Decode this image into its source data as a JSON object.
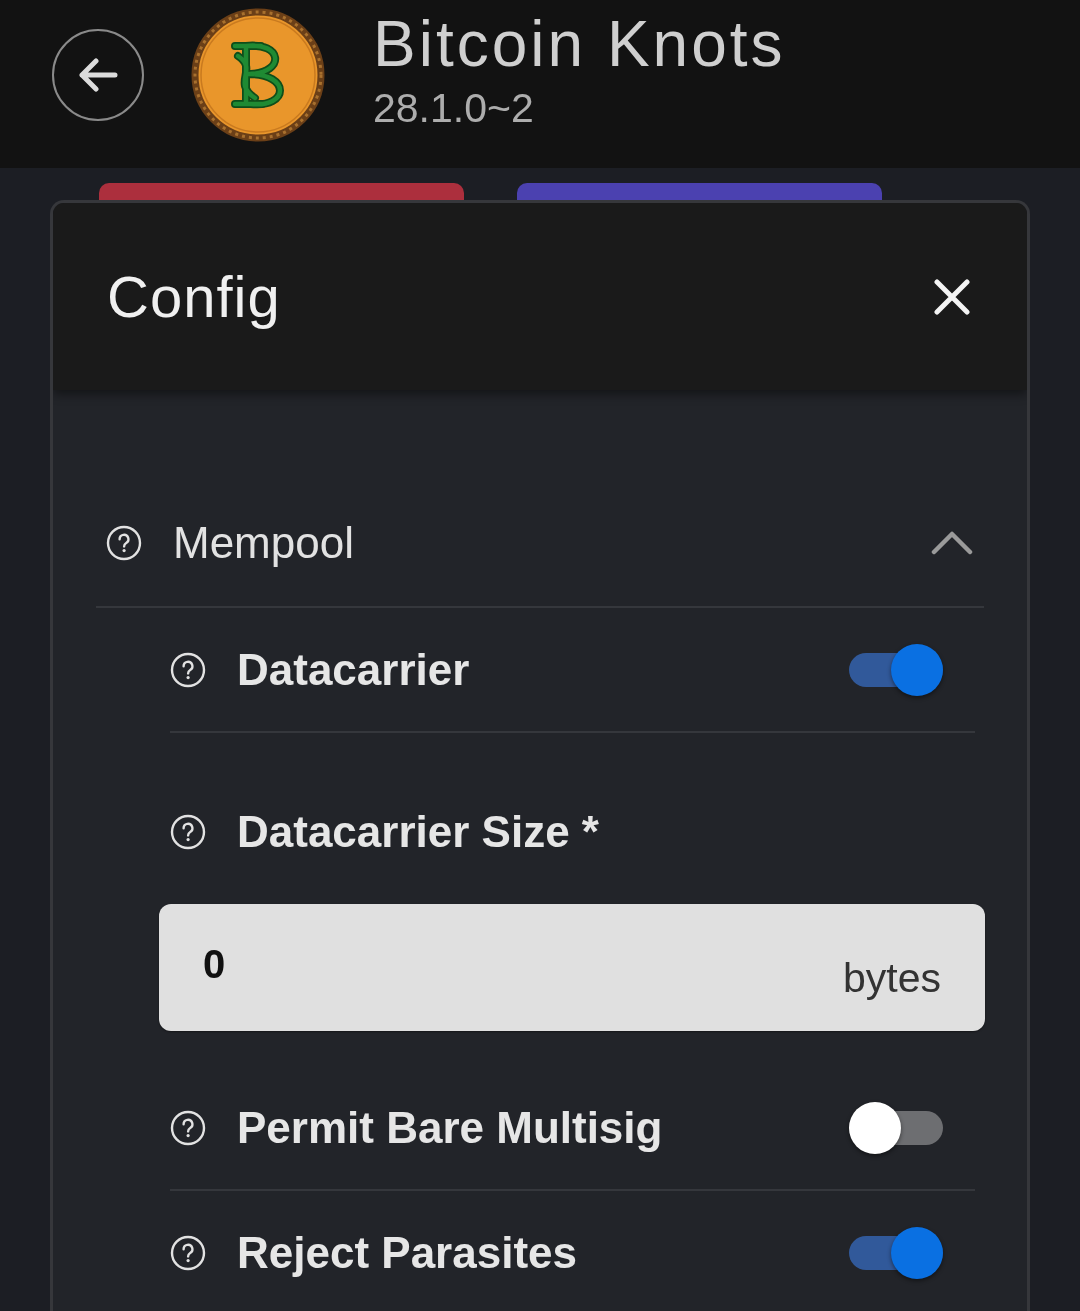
{
  "header": {
    "title": "Bitcoin Knots",
    "version": "28.1.0~2"
  },
  "backdrop_buttons": [
    {
      "color": "#ac2f3d"
    },
    {
      "color": "#4b41b0"
    }
  ],
  "modal": {
    "title": "Config"
  },
  "sections": [
    {
      "title": "Mempool",
      "expanded": true,
      "items": [
        {
          "kind": "toggle",
          "label": "Datacarrier",
          "on": true
        },
        {
          "kind": "number",
          "label": "Datacarrier Size *",
          "value": "0",
          "unit": "bytes"
        },
        {
          "kind": "toggle",
          "label": "Permit Bare Multisig",
          "on": false
        },
        {
          "kind": "toggle",
          "label": "Reject Parasites",
          "on": true
        }
      ]
    }
  ]
}
